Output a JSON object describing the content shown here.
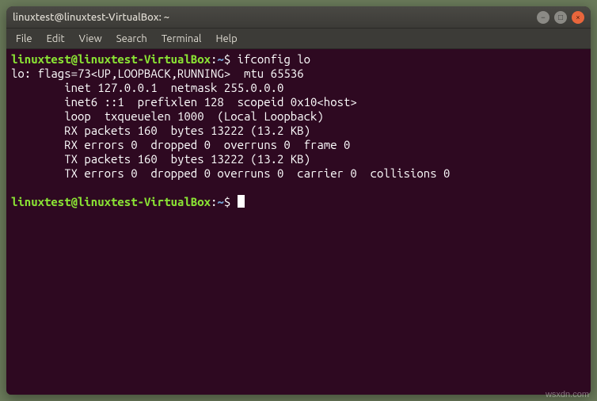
{
  "window": {
    "title": "linuxtest@linuxtest-VirtualBox: ~"
  },
  "menu": {
    "file": "File",
    "edit": "Edit",
    "view": "View",
    "search": "Search",
    "terminal": "Terminal",
    "help": "Help"
  },
  "prompt": {
    "user_host": "linuxtest@linuxtest-VirtualBox",
    "sep": ":",
    "path": "~",
    "sigil": "$"
  },
  "session": {
    "command1": "ifconfig lo",
    "out1": "lo: flags=73<UP,LOOPBACK,RUNNING>  mtu 65536",
    "out2": "        inet 127.0.0.1  netmask 255.0.0.0",
    "out3": "        inet6 ::1  prefixlen 128  scopeid 0x10<host>",
    "out4": "        loop  txqueuelen 1000  (Local Loopback)",
    "out5": "        RX packets 160  bytes 13222 (13.2 KB)",
    "out6": "        RX errors 0  dropped 0  overruns 0  frame 0",
    "out7": "        TX packets 160  bytes 13222 (13.2 KB)",
    "out8": "        TX errors 0  dropped 0 overruns 0  carrier 0  collisions 0"
  },
  "win_icons": {
    "min": "−",
    "max": "□",
    "close": "×"
  },
  "watermark": "wsxdn.com"
}
